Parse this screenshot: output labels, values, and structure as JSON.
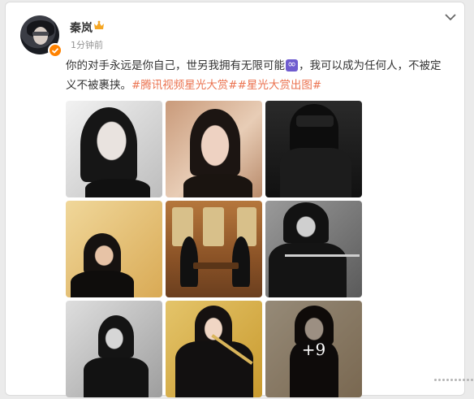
{
  "post": {
    "username": "秦岚",
    "time": "1分钟前",
    "text_part1": "你的对手永远是你自己，世另我拥有无限可能",
    "emoji_symbol": "∞",
    "text_part2": "，我可以成为任何人，不被定义不被裹挟。",
    "hashtags": [
      "#腾讯视频星光大赏#",
      "#星光大赏出图#"
    ],
    "more_images": "+9"
  },
  "colors": {
    "hashtag": "#eb7350",
    "verified": "#ff8200",
    "crown": "#f5a623"
  },
  "icons": [
    "verified-badge-icon",
    "crown-icon",
    "chevron-down-icon",
    "more-dots-icon"
  ]
}
